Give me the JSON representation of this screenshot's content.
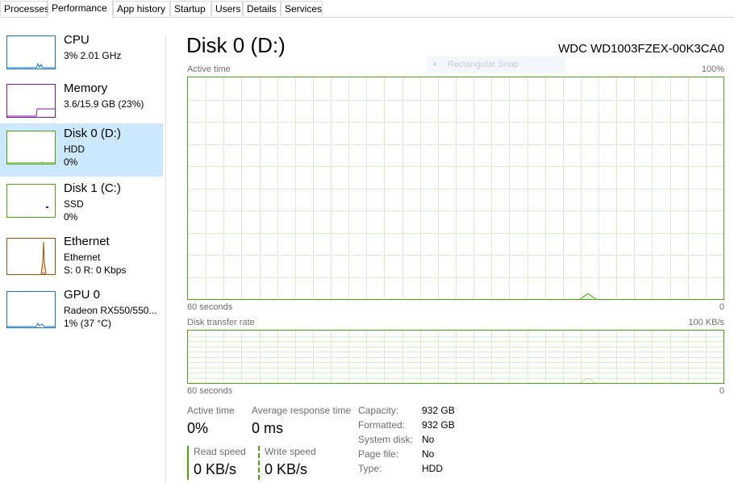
{
  "tabs": [
    {
      "label": "Processes",
      "active": false
    },
    {
      "label": "Performance",
      "active": true
    },
    {
      "label": "App history",
      "active": false
    },
    {
      "label": "Startup",
      "active": false
    },
    {
      "label": "Users",
      "active": false
    },
    {
      "label": "Details",
      "active": false
    },
    {
      "label": "Services",
      "active": false
    }
  ],
  "sidebar": {
    "items": [
      {
        "title": "CPU",
        "line1": "3% 2.01 GHz",
        "line2": "",
        "color": "#1778c7",
        "selected": false
      },
      {
        "title": "Memory",
        "line1": "3.6/15.9 GB (23%)",
        "line2": "",
        "color": "#8b12ae",
        "selected": false
      },
      {
        "title": "Disk 0 (D:)",
        "line1": "HDD",
        "line2": "0%",
        "color": "#4da60c",
        "selected": true
      },
      {
        "title": "Disk 1 (C:)",
        "line1": "SSD",
        "line2": "0%",
        "color": "#4da60c",
        "selected": false
      },
      {
        "title": "Ethernet",
        "line1": "Ethernet",
        "line2": "S: 0 R: 0 Kbps",
        "color": "#a74f01",
        "selected": false
      },
      {
        "title": "GPU 0",
        "line1": "Radeon RX550/550...",
        "line2": "1% (37 °C)",
        "color": "#1778c7",
        "selected": false
      }
    ]
  },
  "main": {
    "title": "Disk 0 (D:)",
    "device_model": "WDC WD1003FZEX-00K3CA0",
    "ghost_tooltip": "Rectangular Snap",
    "active_time_graph": {
      "label": "Active time",
      "max_label": "100%",
      "time_label": "60 seconds",
      "min_label": "0"
    },
    "transfer_rate_graph": {
      "label": "Disk transfer rate",
      "max_label": "100 KB/s",
      "time_label": "60 seconds",
      "min_label": "0"
    },
    "graph_color": "#4da60c",
    "grid_color": "#d9efc9",
    "stats": {
      "active_time": {
        "label": "Active time",
        "value": "0%"
      },
      "avg_response": {
        "label": "Average response time",
        "value": "0 ms"
      },
      "read_speed": {
        "label": "Read speed",
        "value": "0 KB/s"
      },
      "write_speed": {
        "label": "Write speed",
        "value": "0 KB/s"
      }
    },
    "properties": [
      {
        "label": "Capacity:",
        "value": "932 GB"
      },
      {
        "label": "Formatted:",
        "value": "932 GB"
      },
      {
        "label": "System disk:",
        "value": "No"
      },
      {
        "label": "Page file:",
        "value": "No"
      },
      {
        "label": "Type:",
        "value": "HDD"
      }
    ]
  }
}
